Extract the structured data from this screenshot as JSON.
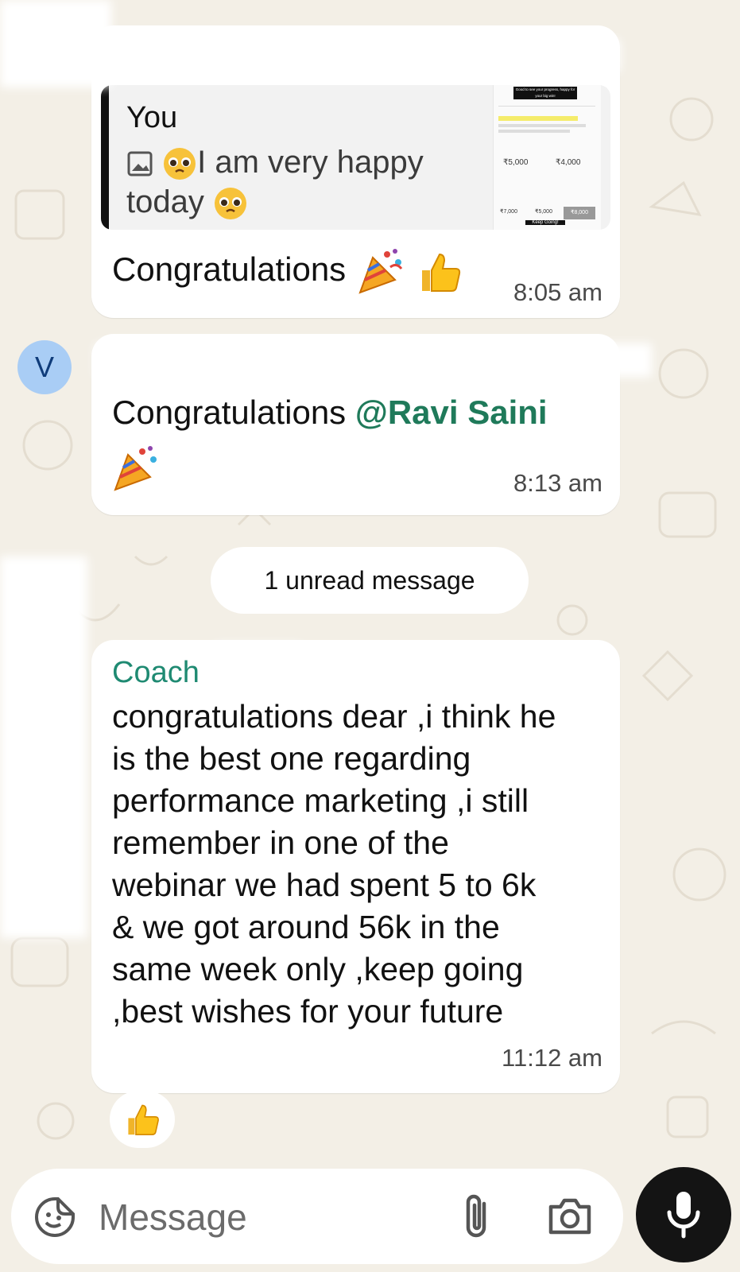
{
  "messages": [
    {
      "quote": {
        "author": "You",
        "text": "I am very happy today"
      },
      "image_caption": "Good to see your progress, happy for your big win!",
      "image_values": [
        "₹5,000",
        "₹4,000",
        "₹7,000",
        "₹5,000",
        "₹8,000"
      ],
      "image_footer": "Keep Going!",
      "text": "Congratulations",
      "time": "8:05 am"
    },
    {
      "avatar_letter": "V",
      "text": "Congratulations ",
      "mention": "@Ravi Saini",
      "time": "8:13 am"
    },
    {
      "sender": "Coach",
      "text": "congratulations dear ,i think he is the best one regarding performance marketing ,i still remember in one of the webinar we had spent 5 to 6k & we got around 56k in the same week only ,keep going ,best wishes for your future",
      "time": "11:12 am"
    }
  ],
  "unread_divider": "1 unread message",
  "input": {
    "placeholder": "Message"
  },
  "icons": [
    "sticker-icon",
    "attach-icon",
    "camera-icon",
    "mic-icon",
    "image-icon",
    "thumbs-up-icon",
    "party-popper-icon",
    "pleading-face-icon"
  ],
  "colors": {
    "wallpaper": "#f3efe6",
    "bubble": "#ffffff",
    "mention": "#1f7a5a",
    "sender": "#1f8a72",
    "mic_button": "#141414",
    "avatar": "#a9cdf5"
  }
}
